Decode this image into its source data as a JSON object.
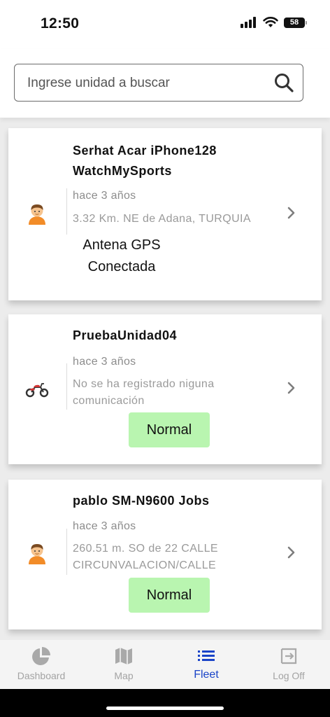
{
  "status_bar": {
    "time": "12:50",
    "battery": "58"
  },
  "search": {
    "placeholder": "Ingrese unidad a buscar"
  },
  "units": [
    {
      "title": "Serhat Acar iPhone128 WatchMySports",
      "time": "hace 3 años",
      "location": "3.32 Km. NE de Adana, TURQUIA",
      "status": "Antena GPS Conectada",
      "icon": "person-icon"
    },
    {
      "title": "PruebaUnidad04",
      "time": "hace 3 años",
      "location": "No se ha registrado niguna comunicación",
      "status": "Normal",
      "icon": "motorcycle-icon"
    },
    {
      "title": "pablo SM-N9600 Jobs",
      "time": "hace 3 años",
      "location": "260.51 m. SO de 22 CALLE CIRCUNVALACION/CALLE",
      "status": "Normal",
      "icon": "person-icon"
    }
  ],
  "tabs": [
    {
      "label": "Dashboard",
      "icon": "pie-chart-icon"
    },
    {
      "label": "Map",
      "icon": "map-icon"
    },
    {
      "label": "Fleet",
      "icon": "list-icon",
      "active": true
    },
    {
      "label": "Log Off",
      "icon": "logout-icon"
    }
  ],
  "colors": {
    "accent": "#1a44c8",
    "status_green": "#b9f5b0",
    "list_background": "#ececec"
  }
}
